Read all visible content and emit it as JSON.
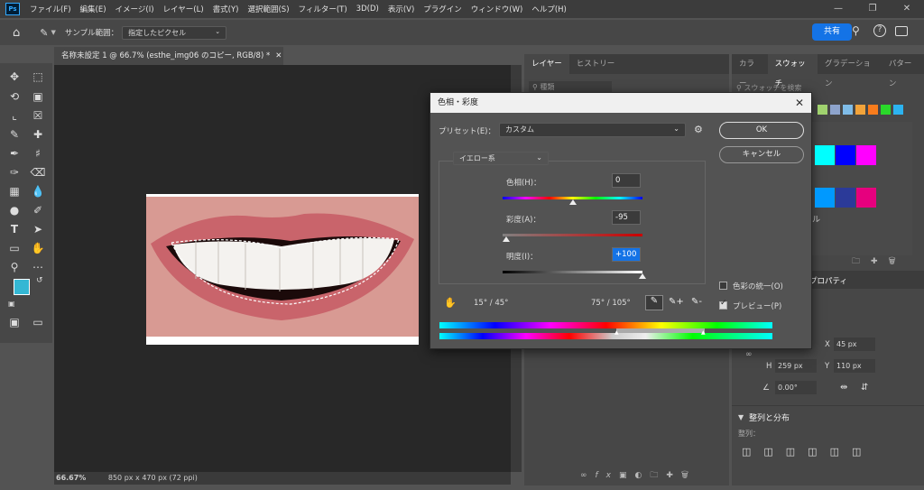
{
  "menu": [
    "ファイル(F)",
    "編集(E)",
    "イメージ(I)",
    "レイヤー(L)",
    "書式(Y)",
    "選択範囲(S)",
    "フィルター(T)",
    "3D(D)",
    "表示(V)",
    "プラグイン",
    "ウィンドウ(W)",
    "ヘルプ(H)"
  ],
  "logo": "Ps",
  "optbar": {
    "sample_label": "サンプル範囲：",
    "sample_value": "指定したピクセル",
    "share": "共有"
  },
  "doc": {
    "tab_title": "名称未設定 1 @ 66.7% (esthe_img06 のコピー, RGB/8) *",
    "zoom": "66.67%",
    "info": "850 px x 470 px (72 ppi)"
  },
  "layers": {
    "tabs": [
      "レイヤー",
      "ヒストリー"
    ],
    "search": "種類"
  },
  "right": {
    "tabs": [
      "カラー",
      "スウォッチ",
      "グラデーション",
      "パターン"
    ],
    "search": "スウォッチを検索",
    "properties": "プロパティ",
    "x_label": "X",
    "x_value": "45 px",
    "h_label": "H",
    "h_value": "259 px",
    "y_label": "Y",
    "y_value": "110 px",
    "angle": "0.00°",
    "align": "整列と分布",
    "align_sub": "整列：",
    "glyph_ru": "ル"
  },
  "dialog": {
    "title": "色相・彩度",
    "preset_label": "プリセット(E)：",
    "preset_value": "カスタム",
    "ok": "OK",
    "cancel": "キャンセル",
    "channel": "イエロー系",
    "hue_label": "色相(H)：",
    "hue_value": "0",
    "hue_level": 0.5,
    "sat_label": "彩度(A)：",
    "sat_value": "-95",
    "sat_level": 0.025,
    "light_label": "明度(I)：",
    "light_value": "+100",
    "light_level": 1.0,
    "range_left": "15° / 45°",
    "range_right": "75° / 105°",
    "colorize": "色彩の統一(O)",
    "preview": "プレビュー(P)",
    "colorize_checked": false,
    "preview_checked": true
  },
  "swatch_colors": [
    "#00ffff",
    "#0000ff",
    "#ff00ff",
    "#0099ff",
    "#2b3a99",
    "#e6007e"
  ],
  "swatch_row": [
    "#a0d26e",
    "#8ea4cc",
    "#7fbce8",
    "#f2a33a",
    "#f97c1c",
    "#2ad92a",
    "#2cb3f0"
  ]
}
